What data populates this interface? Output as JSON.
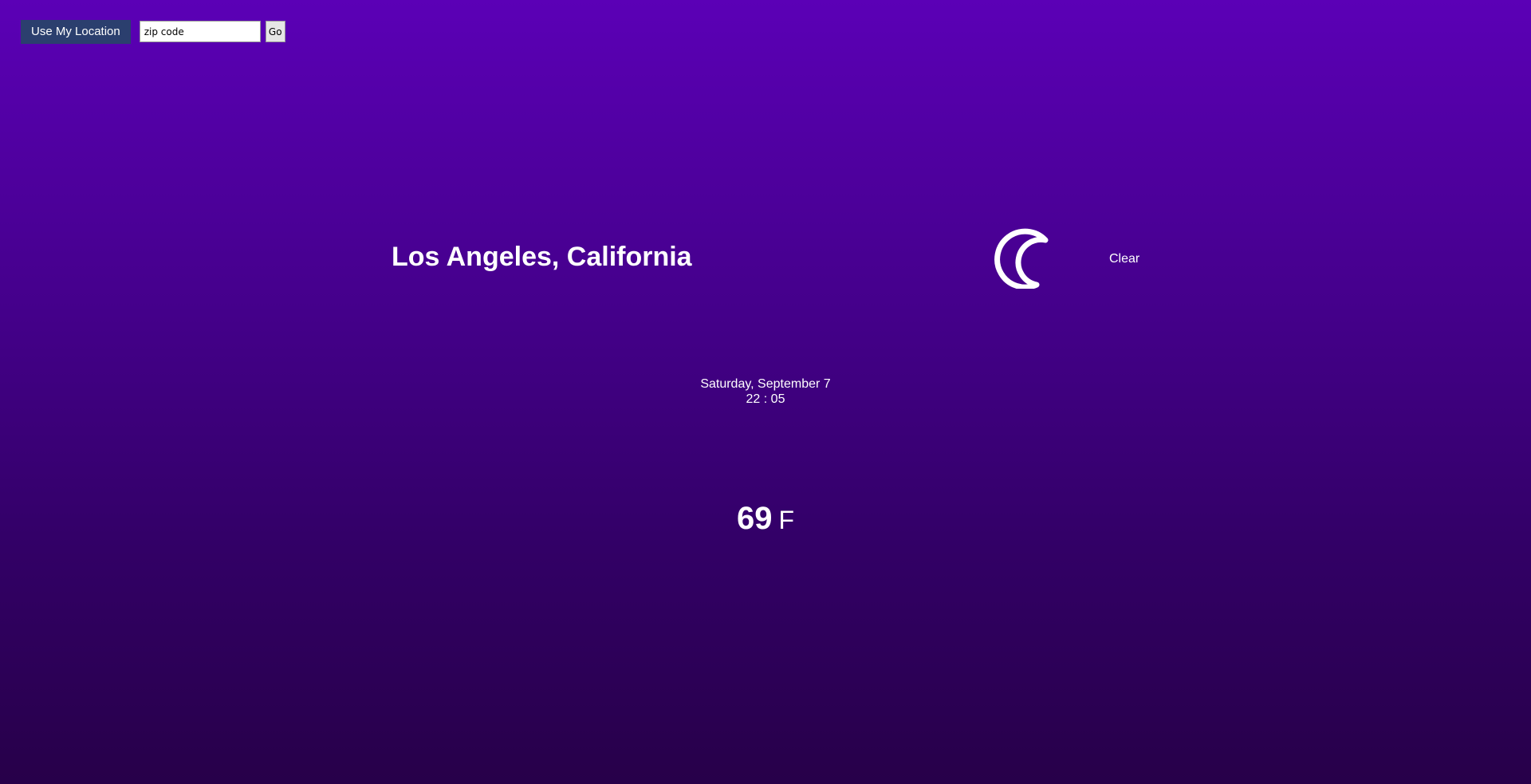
{
  "toolbar": {
    "location_button_label": "Use My Location",
    "zip_placeholder": "zip code",
    "zip_value": "",
    "go_button_label": "Go",
    "location_button_color": "#2b3f6e"
  },
  "weather": {
    "city": "Los Angeles, California",
    "icon": "crescent-moon-icon",
    "condition": "Clear",
    "date": "Saturday, September 7",
    "time": "22 : 05",
    "temperature": "69",
    "unit": "F"
  },
  "theme": {
    "background_top": "#5b00b6",
    "background_bottom": "#270049",
    "text_color": "#ffffff"
  }
}
